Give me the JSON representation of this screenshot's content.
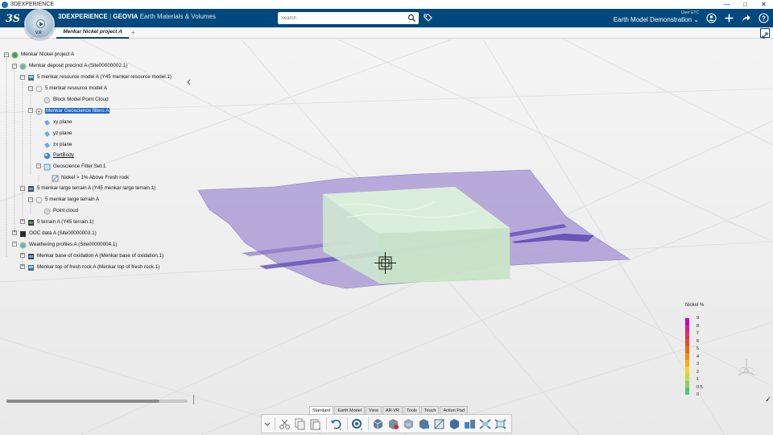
{
  "window": {
    "title": "3DEXPERIENCE",
    "controls": [
      "—",
      "□",
      "✕"
    ]
  },
  "topbar": {
    "brand_bold": "3DEXPERIENCE",
    "brand_sep": " | ",
    "brand_product": "GEOVIA",
    "brand_app": "Earth Materials & Volumes",
    "search_placeholder": "Search",
    "user_name": "User ETC",
    "collab_space": "Earth Model Demonstration ⌄",
    "icons": [
      "user-icon",
      "add-icon",
      "share-icon",
      "help-icon"
    ]
  },
  "compass": {
    "label": "V,R"
  },
  "tabs": {
    "active": "Menkar Nickel project A",
    "add": "+"
  },
  "tree": {
    "nodes": [
      {
        "label": "Menkar Nickel project A",
        "icon": "project-icon"
      },
      {
        "label": "Menkar deposit precinct A (Site00000002.1)",
        "icon": "site-icon"
      },
      {
        "label": "5 menkar resource model A (Y45 menkar resource model.1)",
        "icon": "model-icon"
      },
      {
        "label": "5 menkar resource model A",
        "icon": "dataset-icon"
      },
      {
        "label": "Block Model Point Cloud",
        "icon": "pointcloud-icon"
      },
      {
        "label": "Menkar Geoscience filters A",
        "icon": "filter-icon",
        "selected": true
      },
      {
        "label": "xy plane",
        "icon": "plane-icon"
      },
      {
        "label": "yz plane",
        "icon": "plane-icon"
      },
      {
        "label": "zx plane",
        "icon": "plane-icon"
      },
      {
        "label": "PartBody",
        "icon": "body-icon",
        "underline": true
      },
      {
        "label": "Geoscience Filter Set.1",
        "icon": "filterset-icon"
      },
      {
        "label": "Nickel > 1% Above Fresh rock",
        "icon": "filter-item-icon"
      },
      {
        "label": "5 menkar large terrain A (Y45 menkar large terrain.1)",
        "icon": "model-icon"
      },
      {
        "label": "5 menkar large terrain A",
        "icon": "dataset-icon"
      },
      {
        "label": "Point cloud",
        "icon": "pointcloud-icon"
      },
      {
        "label": "5 terrain A (Y45 terrain.1)",
        "icon": "model-icon"
      },
      {
        "label": "OOC data A (Site00000003.1)",
        "icon": "site-icon"
      },
      {
        "label": "Weathering profiles A (Site00000004.1)",
        "icon": "site-icon"
      },
      {
        "label": "Menkar base of oxidation A (Menkar base of oxidation.1)",
        "icon": "model-icon"
      },
      {
        "label": "Menkar top of fresh rock A (Menkar top of fresh rock.1)",
        "icon": "model-icon"
      }
    ]
  },
  "legend": {
    "title": "Nickel %",
    "labels": [
      "9",
      "8",
      "7",
      "6",
      "5",
      "4",
      "3",
      "2",
      "1",
      "0.5",
      "0"
    ],
    "colors": [
      "#c000c0",
      "#d81e8c",
      "#e23055",
      "#e84a2c",
      "#ec6a1c",
      "#f08c14",
      "#f2b214",
      "#eed22a",
      "#c8dc3a",
      "#8cd260",
      "#48c878"
    ]
  },
  "actionbar": {
    "tabs": [
      "Standard",
      "Earth Model",
      "View",
      "AR-VR",
      "Tools",
      "Touch",
      "Action Pad"
    ],
    "active_tab": "Standard"
  },
  "colors": {
    "topbar": "#00497c",
    "surface_purple": "#a99ad6",
    "block_green": "#cfe8cf",
    "selection": "#1e63c6"
  }
}
